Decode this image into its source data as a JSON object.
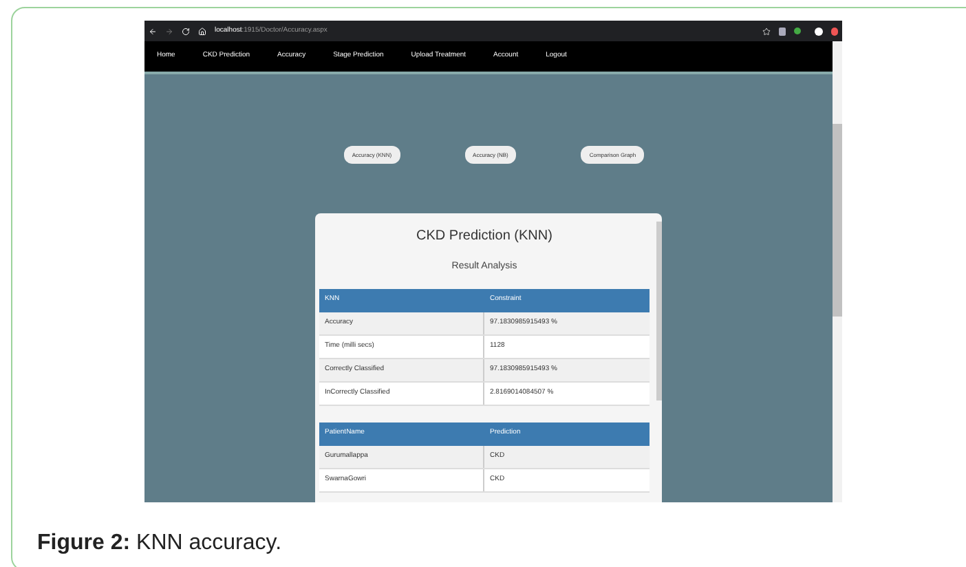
{
  "browser": {
    "url_host": "localhost",
    "url_path": ":1915/Doctor/Accuracy.aspx"
  },
  "nav": [
    {
      "label": "Home"
    },
    {
      "label": "CKD Prediction"
    },
    {
      "label": "Accuracy"
    },
    {
      "label": "Stage Prediction"
    },
    {
      "label": "Upload Treatment"
    },
    {
      "label": "Account"
    },
    {
      "label": "Logout"
    }
  ],
  "buttons": [
    "Accuracy (KNN)",
    "Accuracy (NB)",
    "Comparison Graph"
  ],
  "card": {
    "title": "CKD Prediction (KNN)",
    "subtitle": "Result Analysis",
    "result_table": {
      "columns": [
        "KNN",
        "Constraint"
      ],
      "rows": [
        [
          "Accuracy",
          "97.1830985915493 %"
        ],
        [
          "Time (milli secs)",
          "1128"
        ],
        [
          "Correctly Classified",
          "97.1830985915493 %"
        ],
        [
          "InCorrectly Classified",
          "2.8169014084507 %"
        ]
      ]
    },
    "patient_table": {
      "columns": [
        "PatientName",
        "Prediction"
      ],
      "rows": [
        [
          "Gurumallappa",
          "CKD"
        ],
        [
          "SwarnaGowri",
          "CKD"
        ]
      ]
    }
  },
  "caption": {
    "label": "Figure 2:",
    "text": "KNN accuracy."
  }
}
